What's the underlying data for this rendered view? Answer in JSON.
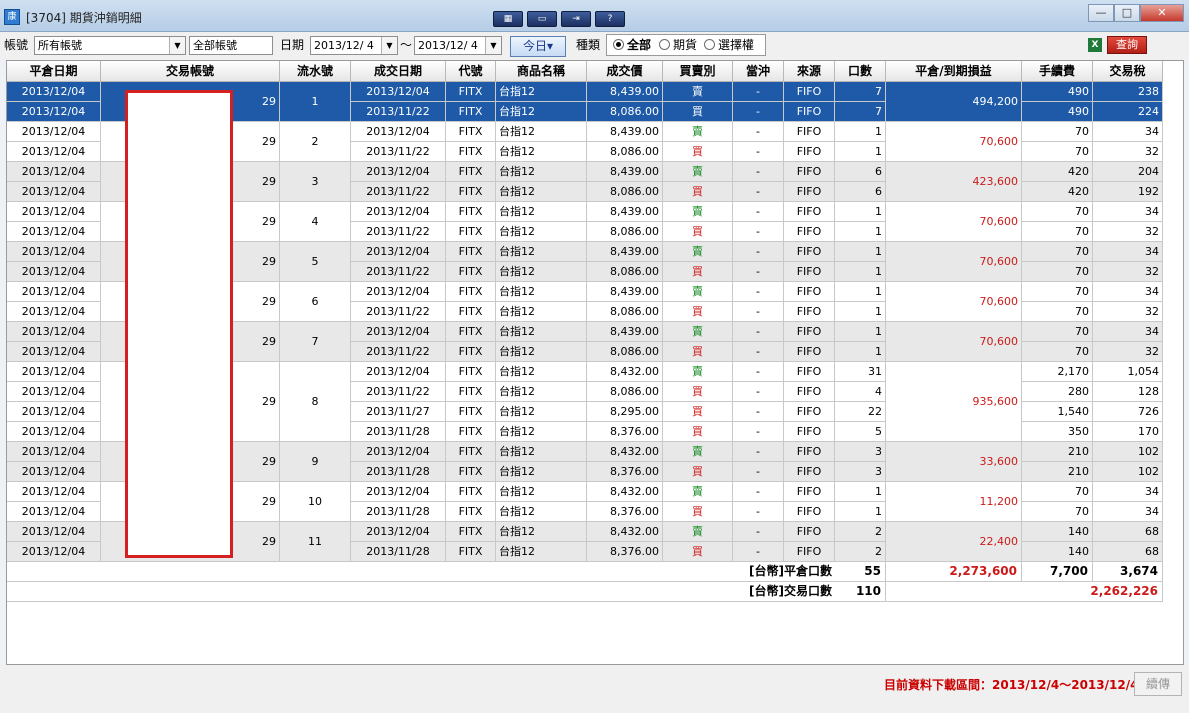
{
  "window": {
    "title": "[3704] 期貨沖銷明細",
    "app_icon_text": "康",
    "toolbar_buttons": [
      "layout-icon",
      "window-icon",
      "screen-icon",
      "help-icon"
    ],
    "toolbar_button_labels": [
      "▦",
      "▭",
      "⇥",
      "?"
    ],
    "controls": {
      "minimize": "—",
      "maximize": "□",
      "close": "✕"
    }
  },
  "filters": {
    "account_label": "帳號",
    "account_select": "所有帳號",
    "account_name": "全部帳號",
    "date_label": "日期",
    "date_from": "2013/12/ 4",
    "date_sep": "～",
    "date_to": "2013/12/ 4",
    "today_button": "今日▾",
    "kind_label": "種類",
    "kind_options": [
      "全部",
      "期貨",
      "選擇權"
    ],
    "kind_selected": 0,
    "excel_icon": "X",
    "query_button": "查詢"
  },
  "table": {
    "columns": [
      "平倉日期",
      "交易帳號",
      "流水號",
      "成交日期",
      "代號",
      "商品名稱",
      "成交價",
      "買賣別",
      "當沖",
      "來源",
      "口數",
      "平倉/到期損益",
      "手續費",
      "交易稅"
    ],
    "groups": [
      {
        "serial": "1",
        "account_suffix": "29",
        "pnl": "494,200",
        "selected": true,
        "rows": [
          {
            "close_date": "2013/12/04",
            "trade_date": "2013/12/04",
            "code": "FITX",
            "name": "台指12",
            "price": "8,439.00",
            "side": "賣",
            "daytrade": "-",
            "source": "FIFO",
            "qty": "7",
            "fee": "490",
            "tax": "238"
          },
          {
            "close_date": "2013/12/04",
            "trade_date": "2013/11/22",
            "code": "FITX",
            "name": "台指12",
            "price": "8,086.00",
            "side": "買",
            "daytrade": "-",
            "source": "FIFO",
            "qty": "7",
            "fee": "490",
            "tax": "224"
          }
        ]
      },
      {
        "serial": "2",
        "account_suffix": "29",
        "pnl": "70,600",
        "rows": [
          {
            "close_date": "2013/12/04",
            "trade_date": "2013/12/04",
            "code": "FITX",
            "name": "台指12",
            "price": "8,439.00",
            "side": "賣",
            "daytrade": "-",
            "source": "FIFO",
            "qty": "1",
            "fee": "70",
            "tax": "34"
          },
          {
            "close_date": "2013/12/04",
            "trade_date": "2013/11/22",
            "code": "FITX",
            "name": "台指12",
            "price": "8,086.00",
            "side": "買",
            "daytrade": "-",
            "source": "FIFO",
            "qty": "1",
            "fee": "70",
            "tax": "32"
          }
        ]
      },
      {
        "serial": "3",
        "account_suffix": "29",
        "pnl": "423,600",
        "rows": [
          {
            "close_date": "2013/12/04",
            "trade_date": "2013/12/04",
            "code": "FITX",
            "name": "台指12",
            "price": "8,439.00",
            "side": "賣",
            "daytrade": "-",
            "source": "FIFO",
            "qty": "6",
            "fee": "420",
            "tax": "204"
          },
          {
            "close_date": "2013/12/04",
            "trade_date": "2013/11/22",
            "code": "FITX",
            "name": "台指12",
            "price": "8,086.00",
            "side": "買",
            "daytrade": "-",
            "source": "FIFO",
            "qty": "6",
            "fee": "420",
            "tax": "192"
          }
        ]
      },
      {
        "serial": "4",
        "account_suffix": "29",
        "pnl": "70,600",
        "rows": [
          {
            "close_date": "2013/12/04",
            "trade_date": "2013/12/04",
            "code": "FITX",
            "name": "台指12",
            "price": "8,439.00",
            "side": "賣",
            "daytrade": "-",
            "source": "FIFO",
            "qty": "1",
            "fee": "70",
            "tax": "34"
          },
          {
            "close_date": "2013/12/04",
            "trade_date": "2013/11/22",
            "code": "FITX",
            "name": "台指12",
            "price": "8,086.00",
            "side": "買",
            "daytrade": "-",
            "source": "FIFO",
            "qty": "1",
            "fee": "70",
            "tax": "32"
          }
        ]
      },
      {
        "serial": "5",
        "account_suffix": "29",
        "pnl": "70,600",
        "rows": [
          {
            "close_date": "2013/12/04",
            "trade_date": "2013/12/04",
            "code": "FITX",
            "name": "台指12",
            "price": "8,439.00",
            "side": "賣",
            "daytrade": "-",
            "source": "FIFO",
            "qty": "1",
            "fee": "70",
            "tax": "34"
          },
          {
            "close_date": "2013/12/04",
            "trade_date": "2013/11/22",
            "code": "FITX",
            "name": "台指12",
            "price": "8,086.00",
            "side": "買",
            "daytrade": "-",
            "source": "FIFO",
            "qty": "1",
            "fee": "70",
            "tax": "32"
          }
        ]
      },
      {
        "serial": "6",
        "account_suffix": "29",
        "pnl": "70,600",
        "rows": [
          {
            "close_date": "2013/12/04",
            "trade_date": "2013/12/04",
            "code": "FITX",
            "name": "台指12",
            "price": "8,439.00",
            "side": "賣",
            "daytrade": "-",
            "source": "FIFO",
            "qty": "1",
            "fee": "70",
            "tax": "34"
          },
          {
            "close_date": "2013/12/04",
            "trade_date": "2013/11/22",
            "code": "FITX",
            "name": "台指12",
            "price": "8,086.00",
            "side": "買",
            "daytrade": "-",
            "source": "FIFO",
            "qty": "1",
            "fee": "70",
            "tax": "32"
          }
        ]
      },
      {
        "serial": "7",
        "account_suffix": "29",
        "pnl": "70,600",
        "rows": [
          {
            "close_date": "2013/12/04",
            "trade_date": "2013/12/04",
            "code": "FITX",
            "name": "台指12",
            "price": "8,439.00",
            "side": "賣",
            "daytrade": "-",
            "source": "FIFO",
            "qty": "1",
            "fee": "70",
            "tax": "34"
          },
          {
            "close_date": "2013/12/04",
            "trade_date": "2013/11/22",
            "code": "FITX",
            "name": "台指12",
            "price": "8,086.00",
            "side": "買",
            "daytrade": "-",
            "source": "FIFO",
            "qty": "1",
            "fee": "70",
            "tax": "32"
          }
        ]
      },
      {
        "serial": "8",
        "account_suffix": "29",
        "pnl": "935,600",
        "rows": [
          {
            "close_date": "2013/12/04",
            "trade_date": "2013/12/04",
            "code": "FITX",
            "name": "台指12",
            "price": "8,432.00",
            "side": "賣",
            "daytrade": "-",
            "source": "FIFO",
            "qty": "31",
            "fee": "2,170",
            "tax": "1,054"
          },
          {
            "close_date": "2013/12/04",
            "trade_date": "2013/11/22",
            "code": "FITX",
            "name": "台指12",
            "price": "8,086.00",
            "side": "買",
            "daytrade": "-",
            "source": "FIFO",
            "qty": "4",
            "fee": "280",
            "tax": "128"
          },
          {
            "close_date": "2013/12/04",
            "trade_date": "2013/11/27",
            "code": "FITX",
            "name": "台指12",
            "price": "8,295.00",
            "side": "買",
            "daytrade": "-",
            "source": "FIFO",
            "qty": "22",
            "fee": "1,540",
            "tax": "726"
          },
          {
            "close_date": "2013/12/04",
            "trade_date": "2013/11/28",
            "code": "FITX",
            "name": "台指12",
            "price": "8,376.00",
            "side": "買",
            "daytrade": "-",
            "source": "FIFO",
            "qty": "5",
            "fee": "350",
            "tax": "170"
          }
        ]
      },
      {
        "serial": "9",
        "account_suffix": "29",
        "pnl": "33,600",
        "rows": [
          {
            "close_date": "2013/12/04",
            "trade_date": "2013/12/04",
            "code": "FITX",
            "name": "台指12",
            "price": "8,432.00",
            "side": "賣",
            "daytrade": "-",
            "source": "FIFO",
            "qty": "3",
            "fee": "210",
            "tax": "102"
          },
          {
            "close_date": "2013/12/04",
            "trade_date": "2013/11/28",
            "code": "FITX",
            "name": "台指12",
            "price": "8,376.00",
            "side": "買",
            "daytrade": "-",
            "source": "FIFO",
            "qty": "3",
            "fee": "210",
            "tax": "102"
          }
        ]
      },
      {
        "serial": "10",
        "account_suffix": "29",
        "pnl": "11,200",
        "rows": [
          {
            "close_date": "2013/12/04",
            "trade_date": "2013/12/04",
            "code": "FITX",
            "name": "台指12",
            "price": "8,432.00",
            "side": "賣",
            "daytrade": "-",
            "source": "FIFO",
            "qty": "1",
            "fee": "70",
            "tax": "34"
          },
          {
            "close_date": "2013/12/04",
            "trade_date": "2013/11/28",
            "code": "FITX",
            "name": "台指12",
            "price": "8,376.00",
            "side": "買",
            "daytrade": "-",
            "source": "FIFO",
            "qty": "1",
            "fee": "70",
            "tax": "34"
          }
        ]
      },
      {
        "serial": "11",
        "account_suffix": "29",
        "pnl": "22,400",
        "rows": [
          {
            "close_date": "2013/12/04",
            "trade_date": "2013/12/04",
            "code": "FITX",
            "name": "台指12",
            "price": "8,432.00",
            "side": "賣",
            "daytrade": "-",
            "source": "FIFO",
            "qty": "2",
            "fee": "140",
            "tax": "68"
          },
          {
            "close_date": "2013/12/04",
            "trade_date": "2013/11/28",
            "code": "FITX",
            "name": "台指12",
            "price": "8,376.00",
            "side": "買",
            "daytrade": "-",
            "source": "FIFO",
            "qty": "2",
            "fee": "140",
            "tax": "68"
          }
        ]
      }
    ],
    "totals": {
      "close_label": "[台幣]平倉口數",
      "close_qty": "55",
      "close_pnl": "2,273,600",
      "close_fee": "7,700",
      "close_tax": "3,674",
      "trade_label": "[台幣]交易口數",
      "trade_qty": "110",
      "net_pnl": "2,262,226"
    }
  },
  "status": {
    "download_range": "目前資料下載區間：2013/12/4～2013/12/4",
    "resume_button": "續傳"
  },
  "colors": {
    "selected_row": "#1e5aa8",
    "sell": "#108a20",
    "buy": "#d11a1a",
    "pnl": "#cc1a1a",
    "alt_row": "#e8e8e8",
    "redaction_border": "#d42020"
  }
}
